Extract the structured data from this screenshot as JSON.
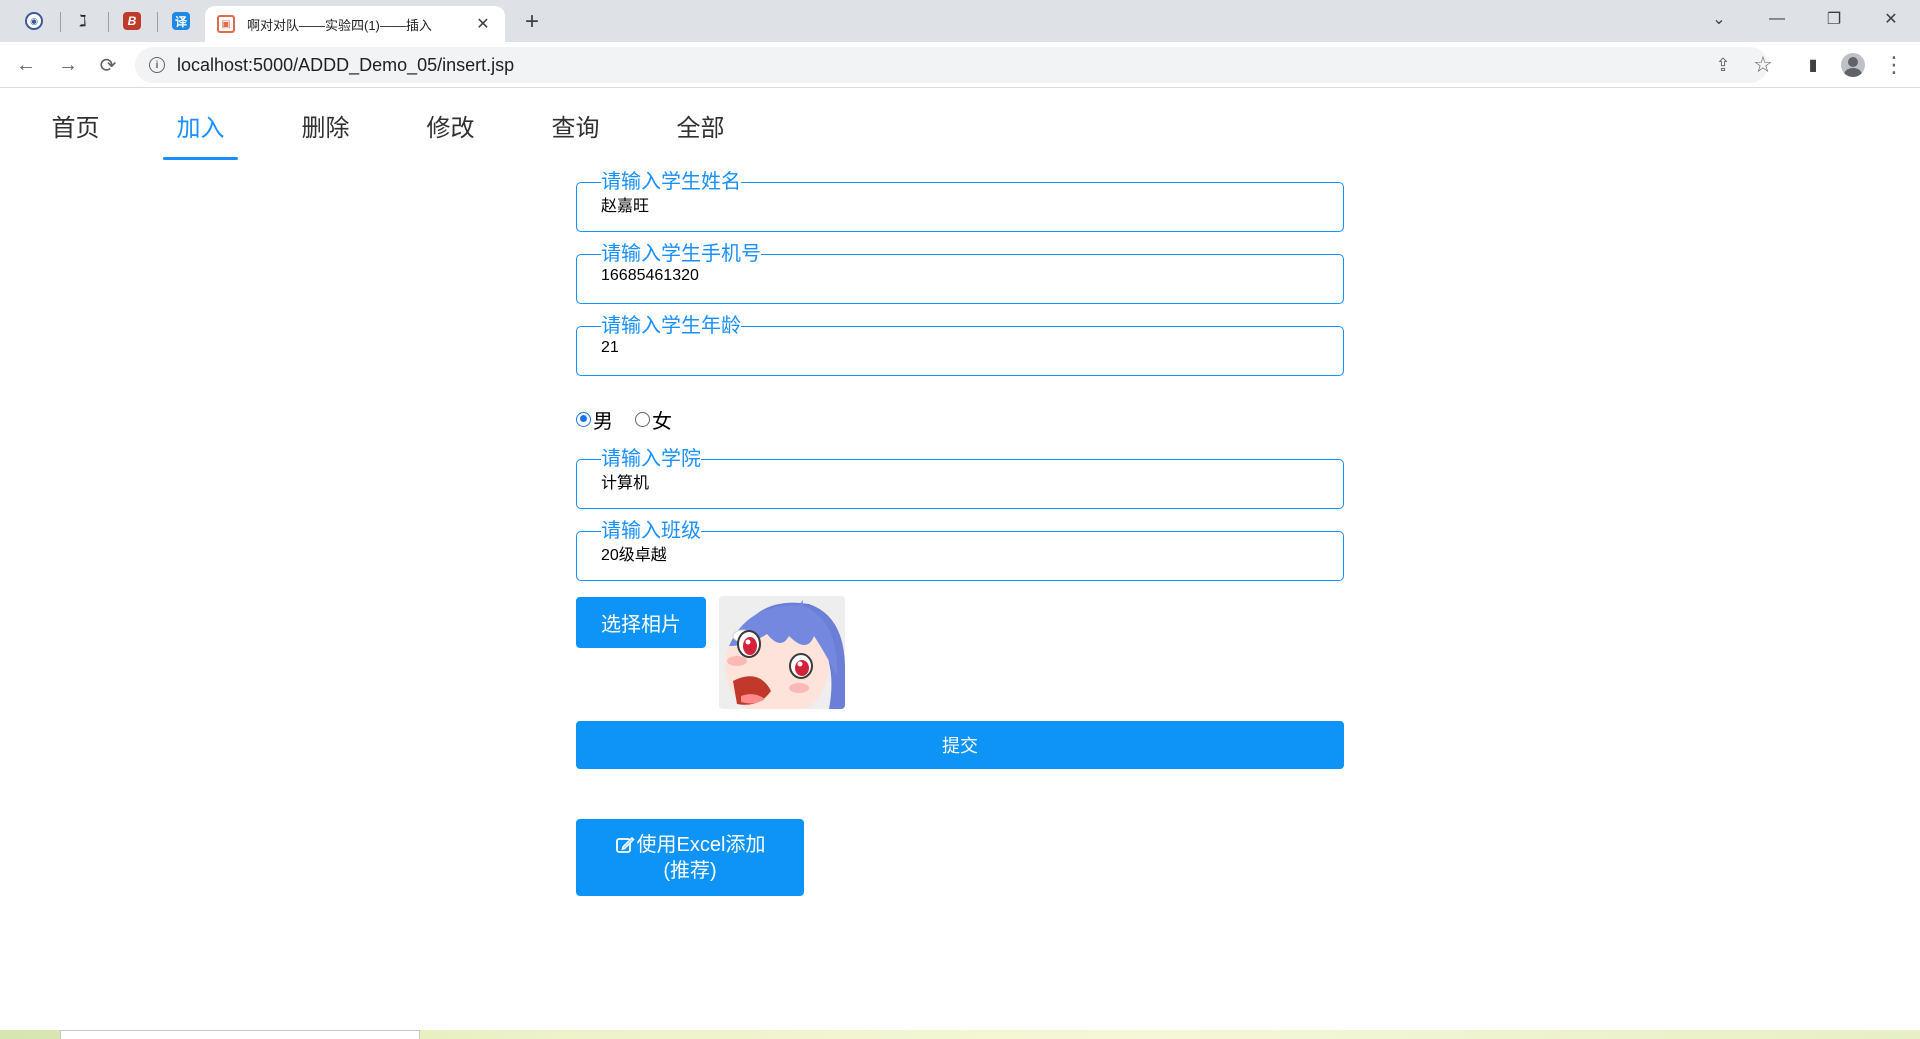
{
  "browser": {
    "pinned_tabs": [
      {
        "icon": "circle-badge-icon",
        "glyph": "◉"
      },
      {
        "icon": "handwriting-icon",
        "glyph": "ℷ"
      },
      {
        "icon": "brand-b-icon",
        "glyph": "B"
      },
      {
        "icon": "translate-icon",
        "glyph": "译"
      }
    ],
    "active_tab": {
      "title": "啊对对队——实验四(1)——插入",
      "close": "✕"
    },
    "new_tab": "+",
    "window_controls": {
      "dropdown": "⌄",
      "minimize": "—",
      "restore": "❐",
      "close": "✕"
    },
    "nav": {
      "back": "←",
      "forward": "→",
      "reload": "⟳"
    },
    "url": "localhost:5000/ADDD_Demo_05/insert.jsp",
    "toolbar_icons": {
      "share": "⇪",
      "star": "☆",
      "sidepanel": "▮",
      "menu": "⋮"
    }
  },
  "page_nav": {
    "items": [
      {
        "label": "首页",
        "active": false
      },
      {
        "label": "加入",
        "active": true
      },
      {
        "label": "删除",
        "active": false
      },
      {
        "label": "修改",
        "active": false
      },
      {
        "label": "查询",
        "active": false
      },
      {
        "label": "全部",
        "active": false
      }
    ]
  },
  "form": {
    "name": {
      "legend": "请输入学生姓名",
      "value": "赵嘉旺"
    },
    "phone": {
      "legend": "请输入学生手机号",
      "value": "16685461320"
    },
    "age": {
      "legend": "请输入学生年龄",
      "value": "21"
    },
    "gender": {
      "options": [
        "男",
        "女"
      ],
      "selected": "男"
    },
    "college": {
      "legend": "请输入学院",
      "value": "计算机"
    },
    "class": {
      "legend": "请输入班级",
      "value": "20级卓越"
    },
    "photo_button": "选择相片",
    "photo_alt": "anime-avatar-image",
    "submit": "提交",
    "excel_button": {
      "line1": "使用Excel添加",
      "line2": "(推荐)"
    }
  },
  "colors": {
    "accent": "#1890ff",
    "button": "#0e93f7",
    "tabstrip": "#dee1e6"
  }
}
